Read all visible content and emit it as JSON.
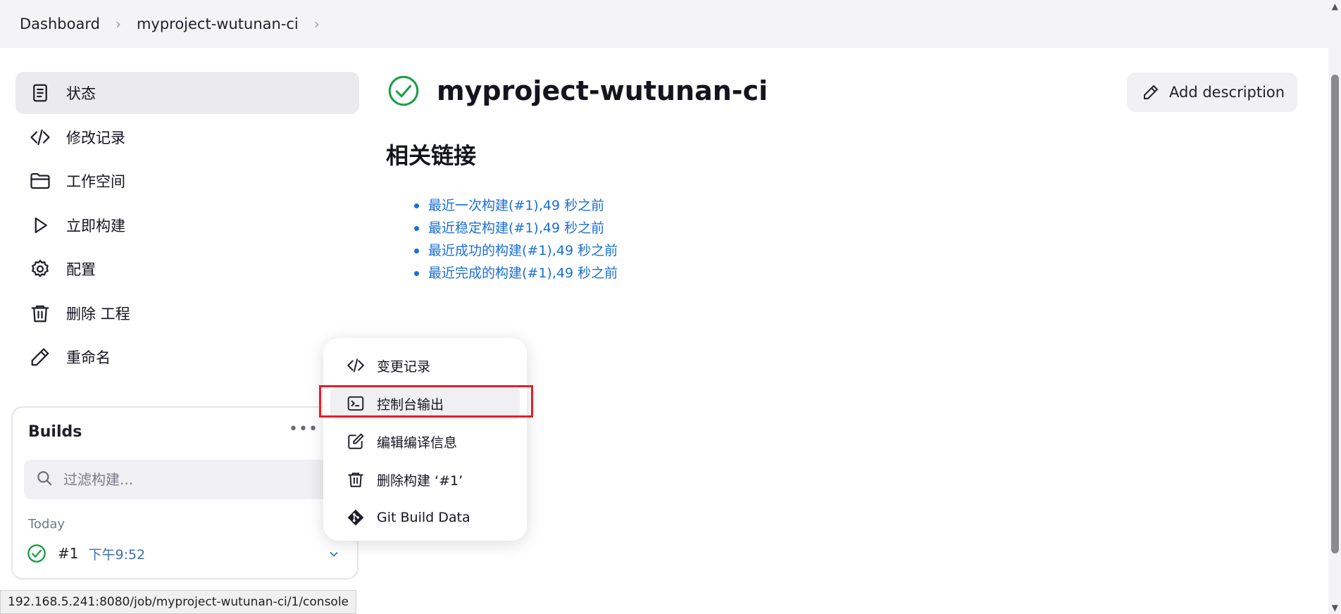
{
  "breadcrumb": {
    "items": [
      "Dashboard",
      "myproject-wutunan-ci"
    ],
    "separator": ">"
  },
  "sidebar": {
    "items": [
      {
        "label": "状态",
        "icon": "document-icon",
        "active": true
      },
      {
        "label": "修改记录",
        "icon": "code-icon"
      },
      {
        "label": "工作空间",
        "icon": "folder-icon"
      },
      {
        "label": "立即构建",
        "icon": "play-icon"
      },
      {
        "label": "配置",
        "icon": "gear-icon"
      },
      {
        "label": "删除 工程",
        "icon": "trash-icon"
      },
      {
        "label": "重命名",
        "icon": "pencil-icon"
      }
    ]
  },
  "builds": {
    "title": "Builds",
    "more": "•••",
    "filter_placeholder": "过滤构建...",
    "group_label": "Today",
    "items": [
      {
        "number": "#1",
        "time": "下午9:52",
        "status": "success"
      }
    ]
  },
  "main": {
    "title": "myproject-wutunan-ci",
    "add_description": "Add description",
    "section_title": "相关链接",
    "links": [
      "最近一次构建(#1),49 秒之前",
      "最近稳定构建(#1),49 秒之前",
      "最近成功的构建(#1),49 秒之前",
      "最近完成的构建(#1),49 秒之前"
    ]
  },
  "context_menu": {
    "items": [
      {
        "label": "变更记录",
        "icon": "code-icon"
      },
      {
        "label": "控制台输出",
        "icon": "terminal-icon",
        "highlighted": true
      },
      {
        "label": "编辑编译信息",
        "icon": "edit-icon"
      },
      {
        "label": "删除构建 ‘#1’",
        "icon": "trash-icon"
      },
      {
        "label": "Git Build Data",
        "icon": "git-icon"
      }
    ]
  },
  "status_bar": {
    "url": "192.168.5.241:8080/job/myproject-wutunan-ci/1/console"
  },
  "colors": {
    "success": "#1a9e45",
    "link": "#1a6fd6",
    "highlight": "#e0202a"
  }
}
